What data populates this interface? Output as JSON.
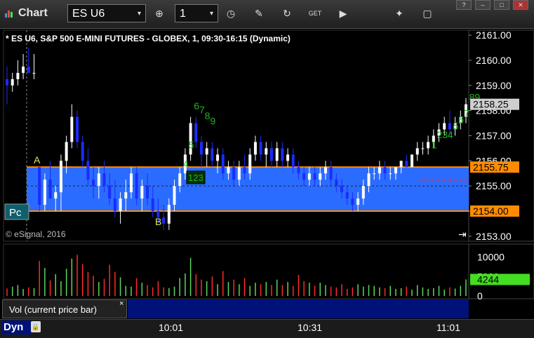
{
  "toolbar": {
    "title": "Chart",
    "symbol": "ES U6",
    "interval": "1",
    "icons": [
      "crosshair-icon",
      "clock-icon",
      "draw-pen-icon",
      "refresh-icon",
      "get-icon",
      "play-icon",
      "tools-icon",
      "comment-icon"
    ],
    "window_controls": [
      "?",
      "–",
      "□",
      "✕"
    ]
  },
  "chart": {
    "title": "* ES U6, S&P 500 E-MINI FUTURES - GLOBEX, 1, 09:30-16:15 (Dynamic)",
    "copyright": "© eSignal, 2016",
    "pc_label": "Pc",
    "label_a": "A",
    "label_b": "B",
    "count_box": "123",
    "scroll_icon": "⇥"
  },
  "colors": {
    "up": "#ffffff",
    "down": "#1a2cff",
    "band": "#2a6cff",
    "band_edge": "#ff8c00",
    "count_text": "#1db31d",
    "vol_up": "#5cd65c",
    "vol_down": "#ff2a2a",
    "red_dash": "#ff2a2a"
  },
  "volume_panel": {
    "label": "Vol (current price bar)",
    "close": "×",
    "current": "4244",
    "ticks": [
      "10000",
      "5000",
      "0"
    ]
  },
  "bottom": {
    "dyn": "Dyn",
    "x_ticks": [
      "10:01",
      "10:31",
      "11:01"
    ]
  },
  "chart_data": {
    "type": "candlestick",
    "ylim": [
      2152.8,
      2161.2
    ],
    "y_ticks": [
      "2161.00",
      "2160.00",
      "2159.00",
      "2158.00",
      "2157.00",
      "2156.00",
      "2155.00",
      "2154.00",
      "2153.00"
    ],
    "highlighted_prices": [
      {
        "label": "2158.25",
        "value": 2158.25,
        "style": "gray"
      },
      {
        "label": "2155.75",
        "value": 2155.75,
        "style": "orange"
      },
      {
        "label": "2154.00",
        "value": 2154.0,
        "style": "orange"
      }
    ],
    "band": [
      2154.0,
      2155.75
    ],
    "dashed_level": 2155.0,
    "red_dash_level": 2155.25,
    "bars": [
      {
        "o": 2159.25,
        "h": 2159.75,
        "l": 2158.25,
        "c": 2159.0
      },
      {
        "o": 2159.0,
        "h": 2159.5,
        "l": 2158.75,
        "c": 2159.25
      },
      {
        "o": 2159.25,
        "h": 2160.0,
        "l": 2159.0,
        "c": 2159.5
      },
      {
        "o": 2159.5,
        "h": 2160.25,
        "l": 2159.25,
        "c": 2159.75
      },
      {
        "o": 2159.75,
        "h": 2160.5,
        "l": 2159.5,
        "c": 2159.5
      },
      {
        "o": 2159.5,
        "h": 2160.25,
        "l": 2159.25,
        "c": 2159.5
      },
      {
        "o": 2155.75,
        "h": 2155.75,
        "l": 2154.0,
        "c": 2154.25
      },
      {
        "o": 2154.25,
        "h": 2155.5,
        "l": 2154.0,
        "c": 2155.25
      },
      {
        "o": 2155.25,
        "h": 2156.0,
        "l": 2154.75,
        "c": 2154.5
      },
      {
        "o": 2154.5,
        "h": 2155.0,
        "l": 2154.0,
        "c": 2154.75
      },
      {
        "o": 2154.75,
        "h": 2156.25,
        "l": 2154.0,
        "c": 2156.0
      },
      {
        "o": 2156.0,
        "h": 2157.0,
        "l": 2155.5,
        "c": 2156.75
      },
      {
        "o": 2156.75,
        "h": 2158.25,
        "l": 2156.5,
        "c": 2157.75
      },
      {
        "o": 2157.75,
        "h": 2158.0,
        "l": 2156.5,
        "c": 2156.75
      },
      {
        "o": 2156.75,
        "h": 2157.0,
        "l": 2155.75,
        "c": 2156.0
      },
      {
        "o": 2156.0,
        "h": 2156.5,
        "l": 2155.0,
        "c": 2155.25
      },
      {
        "o": 2155.25,
        "h": 2155.75,
        "l": 2154.5,
        "c": 2155.0
      },
      {
        "o": 2155.0,
        "h": 2155.75,
        "l": 2154.5,
        "c": 2155.5
      },
      {
        "o": 2155.5,
        "h": 2156.0,
        "l": 2154.75,
        "c": 2155.0
      },
      {
        "o": 2155.0,
        "h": 2155.5,
        "l": 2154.25,
        "c": 2154.5
      },
      {
        "o": 2154.5,
        "h": 2155.25,
        "l": 2153.75,
        "c": 2154.0
      },
      {
        "o": 2154.0,
        "h": 2154.75,
        "l": 2153.5,
        "c": 2154.5
      },
      {
        "o": 2154.5,
        "h": 2155.25,
        "l": 2154.0,
        "c": 2154.75
      },
      {
        "o": 2154.75,
        "h": 2155.75,
        "l": 2154.5,
        "c": 2155.5
      },
      {
        "o": 2155.5,
        "h": 2155.75,
        "l": 2154.25,
        "c": 2154.5
      },
      {
        "o": 2154.5,
        "h": 2155.25,
        "l": 2154.0,
        "c": 2155.0
      },
      {
        "o": 2155.0,
        "h": 2155.5,
        "l": 2154.25,
        "c": 2154.5
      },
      {
        "o": 2154.5,
        "h": 2155.0,
        "l": 2153.75,
        "c": 2154.0
      },
      {
        "o": 2154.0,
        "h": 2154.5,
        "l": 2153.5,
        "c": 2153.75
      },
      {
        "o": 2153.75,
        "h": 2154.25,
        "l": 2153.25,
        "c": 2153.5
      },
      {
        "o": 2153.5,
        "h": 2154.5,
        "l": 2153.25,
        "c": 2154.25
      },
      {
        "o": 2154.25,
        "h": 2155.25,
        "l": 2154.0,
        "c": 2155.0
      },
      {
        "o": 2155.0,
        "h": 2155.75,
        "l": 2154.75,
        "c": 2155.5
      },
      {
        "o": 2155.5,
        "h": 2156.5,
        "l": 2155.25,
        "c": 2156.25
      },
      {
        "o": 2156.25,
        "h": 2157.75,
        "l": 2156.0,
        "c": 2157.5
      },
      {
        "o": 2157.5,
        "h": 2157.75,
        "l": 2156.5,
        "c": 2156.75
      },
      {
        "o": 2156.75,
        "h": 2157.0,
        "l": 2155.75,
        "c": 2156.25
      },
      {
        "o": 2156.25,
        "h": 2156.75,
        "l": 2155.75,
        "c": 2156.5
      },
      {
        "o": 2156.5,
        "h": 2156.75,
        "l": 2155.75,
        "c": 2156.0
      },
      {
        "o": 2156.0,
        "h": 2156.5,
        "l": 2155.5,
        "c": 2156.25
      },
      {
        "o": 2156.25,
        "h": 2156.5,
        "l": 2155.25,
        "c": 2155.5
      },
      {
        "o": 2155.5,
        "h": 2156.0,
        "l": 2155.25,
        "c": 2155.75
      },
      {
        "o": 2155.75,
        "h": 2156.0,
        "l": 2155.0,
        "c": 2155.25
      },
      {
        "o": 2155.25,
        "h": 2156.0,
        "l": 2155.0,
        "c": 2155.75
      },
      {
        "o": 2155.75,
        "h": 2156.25,
        "l": 2155.25,
        "c": 2155.5
      },
      {
        "o": 2155.5,
        "h": 2156.5,
        "l": 2155.25,
        "c": 2156.25
      },
      {
        "o": 2156.25,
        "h": 2157.0,
        "l": 2156.0,
        "c": 2156.75
      },
      {
        "o": 2156.75,
        "h": 2157.0,
        "l": 2156.0,
        "c": 2156.25
      },
      {
        "o": 2156.25,
        "h": 2156.75,
        "l": 2155.75,
        "c": 2156.5
      },
      {
        "o": 2156.5,
        "h": 2156.75,
        "l": 2155.75,
        "c": 2156.0
      },
      {
        "o": 2156.0,
        "h": 2156.75,
        "l": 2155.75,
        "c": 2156.5
      },
      {
        "o": 2156.5,
        "h": 2156.75,
        "l": 2155.75,
        "c": 2156.0
      },
      {
        "o": 2156.0,
        "h": 2156.5,
        "l": 2155.75,
        "c": 2156.25
      },
      {
        "o": 2156.25,
        "h": 2156.5,
        "l": 2155.5,
        "c": 2155.75
      },
      {
        "o": 2155.75,
        "h": 2156.0,
        "l": 2155.25,
        "c": 2155.5
      },
      {
        "o": 2155.5,
        "h": 2155.75,
        "l": 2155.0,
        "c": 2155.25
      },
      {
        "o": 2155.25,
        "h": 2155.75,
        "l": 2155.0,
        "c": 2155.5
      },
      {
        "o": 2155.5,
        "h": 2155.75,
        "l": 2155.0,
        "c": 2155.25
      },
      {
        "o": 2155.25,
        "h": 2155.75,
        "l": 2155.0,
        "c": 2155.5
      },
      {
        "o": 2155.5,
        "h": 2156.0,
        "l": 2155.25,
        "c": 2155.75
      },
      {
        "o": 2155.75,
        "h": 2156.0,
        "l": 2155.0,
        "c": 2155.25
      },
      {
        "o": 2155.25,
        "h": 2155.5,
        "l": 2154.75,
        "c": 2155.0
      },
      {
        "o": 2155.0,
        "h": 2155.25,
        "l": 2154.5,
        "c": 2154.75
      },
      {
        "o": 2154.75,
        "h": 2155.0,
        "l": 2154.25,
        "c": 2154.5
      },
      {
        "o": 2154.5,
        "h": 2154.75,
        "l": 2154.0,
        "c": 2154.25
      },
      {
        "o": 2154.25,
        "h": 2154.75,
        "l": 2154.0,
        "c": 2154.5
      },
      {
        "o": 2154.5,
        "h": 2155.25,
        "l": 2154.25,
        "c": 2155.0
      },
      {
        "o": 2155.0,
        "h": 2155.75,
        "l": 2154.75,
        "c": 2155.5
      },
      {
        "o": 2155.5,
        "h": 2155.75,
        "l": 2155.25,
        "c": 2155.5
      },
      {
        "o": 2155.5,
        "h": 2156.0,
        "l": 2155.25,
        "c": 2155.75
      },
      {
        "o": 2155.75,
        "h": 2156.0,
        "l": 2155.25,
        "c": 2155.5
      },
      {
        "o": 2155.5,
        "h": 2155.75,
        "l": 2155.25,
        "c": 2155.5
      },
      {
        "o": 2155.5,
        "h": 2155.75,
        "l": 2155.25,
        "c": 2155.75
      },
      {
        "o": 2155.75,
        "h": 2156.0,
        "l": 2155.5,
        "c": 2156.0
      },
      {
        "o": 2156.0,
        "h": 2156.25,
        "l": 2155.75,
        "c": 2155.75
      },
      {
        "o": 2155.75,
        "h": 2156.25,
        "l": 2155.75,
        "c": 2156.25
      },
      {
        "o": 2156.25,
        "h": 2156.75,
        "l": 2156.0,
        "c": 2156.5
      },
      {
        "o": 2156.5,
        "h": 2156.75,
        "l": 2156.25,
        "c": 2156.5
      },
      {
        "o": 2156.5,
        "h": 2157.0,
        "l": 2156.25,
        "c": 2156.75
      },
      {
        "o": 2156.75,
        "h": 2157.25,
        "l": 2156.5,
        "c": 2157.0
      },
      {
        "o": 2157.0,
        "h": 2157.5,
        "l": 2156.75,
        "c": 2157.25
      },
      {
        "o": 2157.25,
        "h": 2157.75,
        "l": 2157.0,
        "c": 2157.5
      },
      {
        "o": 2157.5,
        "h": 2158.0,
        "l": 2157.0,
        "c": 2157.25
      },
      {
        "o": 2157.25,
        "h": 2157.75,
        "l": 2157.0,
        "c": 2157.5
      },
      {
        "o": 2157.5,
        "h": 2158.0,
        "l": 2157.25,
        "c": 2157.75
      },
      {
        "o": 2157.75,
        "h": 2158.5,
        "l": 2157.5,
        "c": 2158.25
      }
    ],
    "volume": [
      1900,
      2400,
      2800,
      1800,
      2200,
      2000,
      9000,
      7200,
      4000,
      5600,
      3800,
      7000,
      9600,
      10600,
      8200,
      6200,
      5200,
      3600,
      4400,
      8000,
      6200,
      4800,
      2600,
      2400,
      4600,
      3400,
      2800,
      2200,
      3800,
      2200,
      2000,
      2400,
      4600,
      5800,
      9800,
      5600,
      4200,
      3800,
      5000,
      3000,
      6400,
      3600,
      4200,
      3000,
      4600,
      2600,
      3400,
      3000,
      3600,
      2800,
      4200,
      2800,
      3600,
      2600,
      5400,
      3800,
      3400,
      2600,
      3400,
      2800,
      2400,
      2200,
      3000,
      1800,
      2200,
      3000,
      2400,
      2800,
      2600,
      2200,
      2000,
      2600,
      1800,
      2000,
      2400,
      1600,
      2800,
      2200,
      1800,
      2000,
      2600,
      1600,
      2200,
      1900,
      2600,
      4244
    ],
    "annotations": [
      {
        "text": "6",
        "bar": 35,
        "price": 2158.05
      },
      {
        "text": "7",
        "bar": 36,
        "price": 2157.9
      },
      {
        "text": "8",
        "bar": 37,
        "price": 2157.65
      },
      {
        "text": "9",
        "bar": 38,
        "price": 2157.45
      },
      {
        "text": "5",
        "bar": 34,
        "price": 2156.5
      },
      {
        "text": "4",
        "bar": 33,
        "price": 2155.75
      },
      {
        "text": "1",
        "bar": 79,
        "price": 2156.5
      },
      {
        "text": "2",
        "bar": 80,
        "price": 2156.9
      },
      {
        "text": "3",
        "bar": 81,
        "price": 2156.9
      },
      {
        "text": "4",
        "bar": 82,
        "price": 2156.9
      },
      {
        "text": "5",
        "bar": 83,
        "price": 2157.25
      },
      {
        "text": "6",
        "bar": 84,
        "price": 2157.5
      },
      {
        "text": "7",
        "bar": 85,
        "price": 2157.75
      },
      {
        "text": "8",
        "bar": 86,
        "price": 2158.4
      },
      {
        "text": "9",
        "bar": 87,
        "price": 2158.4
      }
    ]
  }
}
